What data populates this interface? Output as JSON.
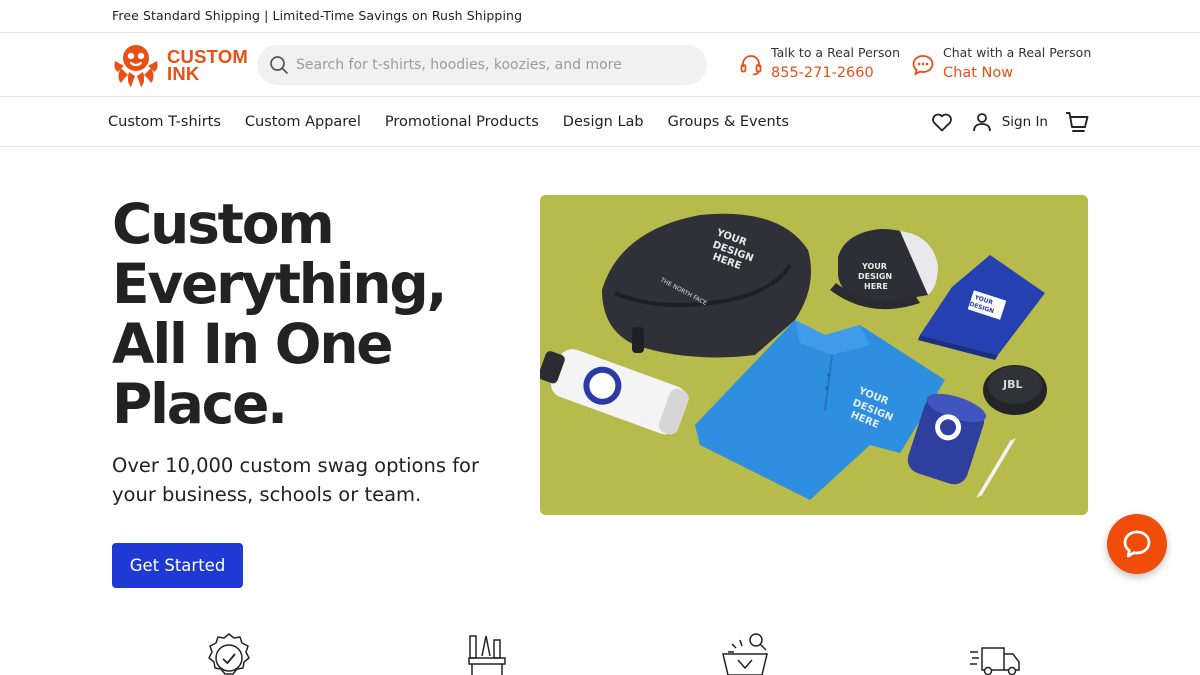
{
  "topbar": {
    "promo": "Free Standard Shipping | Limited-Time Savings on Rush Shipping"
  },
  "header": {
    "logo": {
      "line1": "CUSTOM",
      "line2": "INK",
      "icon": "octopus-logo"
    },
    "search": {
      "placeholder": "Search for t-shirts, hoodies, koozies, and more",
      "value": "",
      "icon": "search-icon"
    },
    "phone": {
      "label": "Talk to a Real Person",
      "value": "855-271-2660",
      "icon": "headset-icon"
    },
    "chat": {
      "label": "Chat with a Real Person",
      "value": "Chat Now",
      "icon": "chat-icon"
    }
  },
  "nav": {
    "items": [
      {
        "label": "Custom T-shirts"
      },
      {
        "label": "Custom Apparel"
      },
      {
        "label": "Promotional Products"
      },
      {
        "label": "Design Lab"
      },
      {
        "label": "Groups & Events"
      }
    ],
    "sign_in": "Sign In",
    "icons": [
      "heart-icon",
      "user-icon",
      "cart-icon"
    ]
  },
  "hero": {
    "title_lines": [
      "Custom",
      "Everything,",
      "All In One",
      "Place."
    ],
    "subtitle": "Over 10,000 custom swag options for your business, schools or team.",
    "cta": "Get Started",
    "image": {
      "description_icon": "product-collection-image",
      "label": "YOUR DESIGN HERE",
      "backpack_brand": "THE NORTH FACE",
      "speaker_brand": "JBL"
    }
  },
  "features": {
    "icons": [
      "quality-badge-icon",
      "design-tools-icon",
      "gift-basket-icon",
      "delivery-truck-icon"
    ]
  },
  "colors": {
    "accent": "#ea4f15",
    "cta": "#1f3ad4",
    "hero_bg": "#b6bb4b",
    "chat_button": "#f04c0a"
  }
}
